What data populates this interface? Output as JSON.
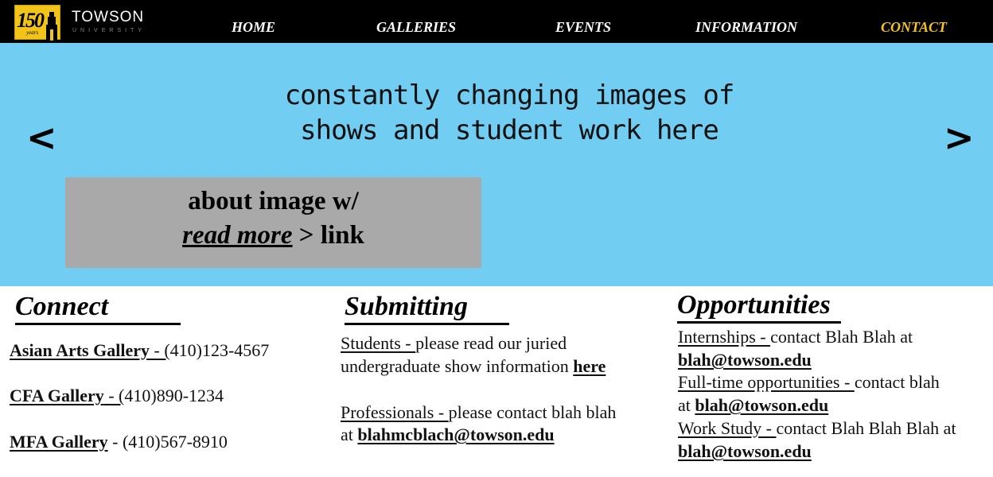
{
  "logo": {
    "anniversary": "150",
    "years": "years",
    "name": "TOWSON",
    "subname": "UNIVERSITY"
  },
  "nav": {
    "items": [
      {
        "label": "HOME",
        "active": false
      },
      {
        "label": "GALLERIES",
        "active": false
      },
      {
        "label": "EVENTS",
        "active": false
      },
      {
        "label": "INFORMATION",
        "active": false
      },
      {
        "label": "CONTACT",
        "active": true
      }
    ],
    "active_color": "#f5c02b"
  },
  "hero": {
    "background": "#72cdf3",
    "text_line1": "constantly changing images of",
    "text_line2": "shows and student work here",
    "prev": "<",
    "next": ">",
    "about": {
      "line1": "about image w/",
      "read_more": "read more",
      "link_suffix": " > link"
    }
  },
  "connect": {
    "title": "Connect",
    "items": [
      {
        "name": "Asian Arts Gallery",
        "sep": " - (",
        "phone": "410)123-4567"
      },
      {
        "name": "CFA Gallery",
        "sep": " - (",
        "phone": "410)890-1234"
      },
      {
        "name": "MFA Gallery",
        "sep": " - ",
        "phone": "(410)567-8910"
      }
    ]
  },
  "submitting": {
    "title": "Submitting",
    "students_label": "Students - ",
    "students_text": "please read our juried",
    "students_text2": "undergraduate show information ",
    "students_link": "here",
    "professionals_label": "Professionals - ",
    "professionals_text": " please contact blah blah",
    "professionals_at": "at ",
    "professionals_email": "blahmcblach@towson.edu"
  },
  "opportunities": {
    "title": "Opportunities",
    "items": [
      {
        "label": "Internships - ",
        "text": "contact Blah Blah at",
        "email": "blah@towson.edu"
      },
      {
        "label": "Full-time opportunities - ",
        "text": "contact blah",
        "at": "at ",
        "email": "blah@towson.edu"
      },
      {
        "label": "Work Study - ",
        "text": "contact Blah Blah Blah at",
        "email": "blah@towson.edu"
      }
    ]
  }
}
